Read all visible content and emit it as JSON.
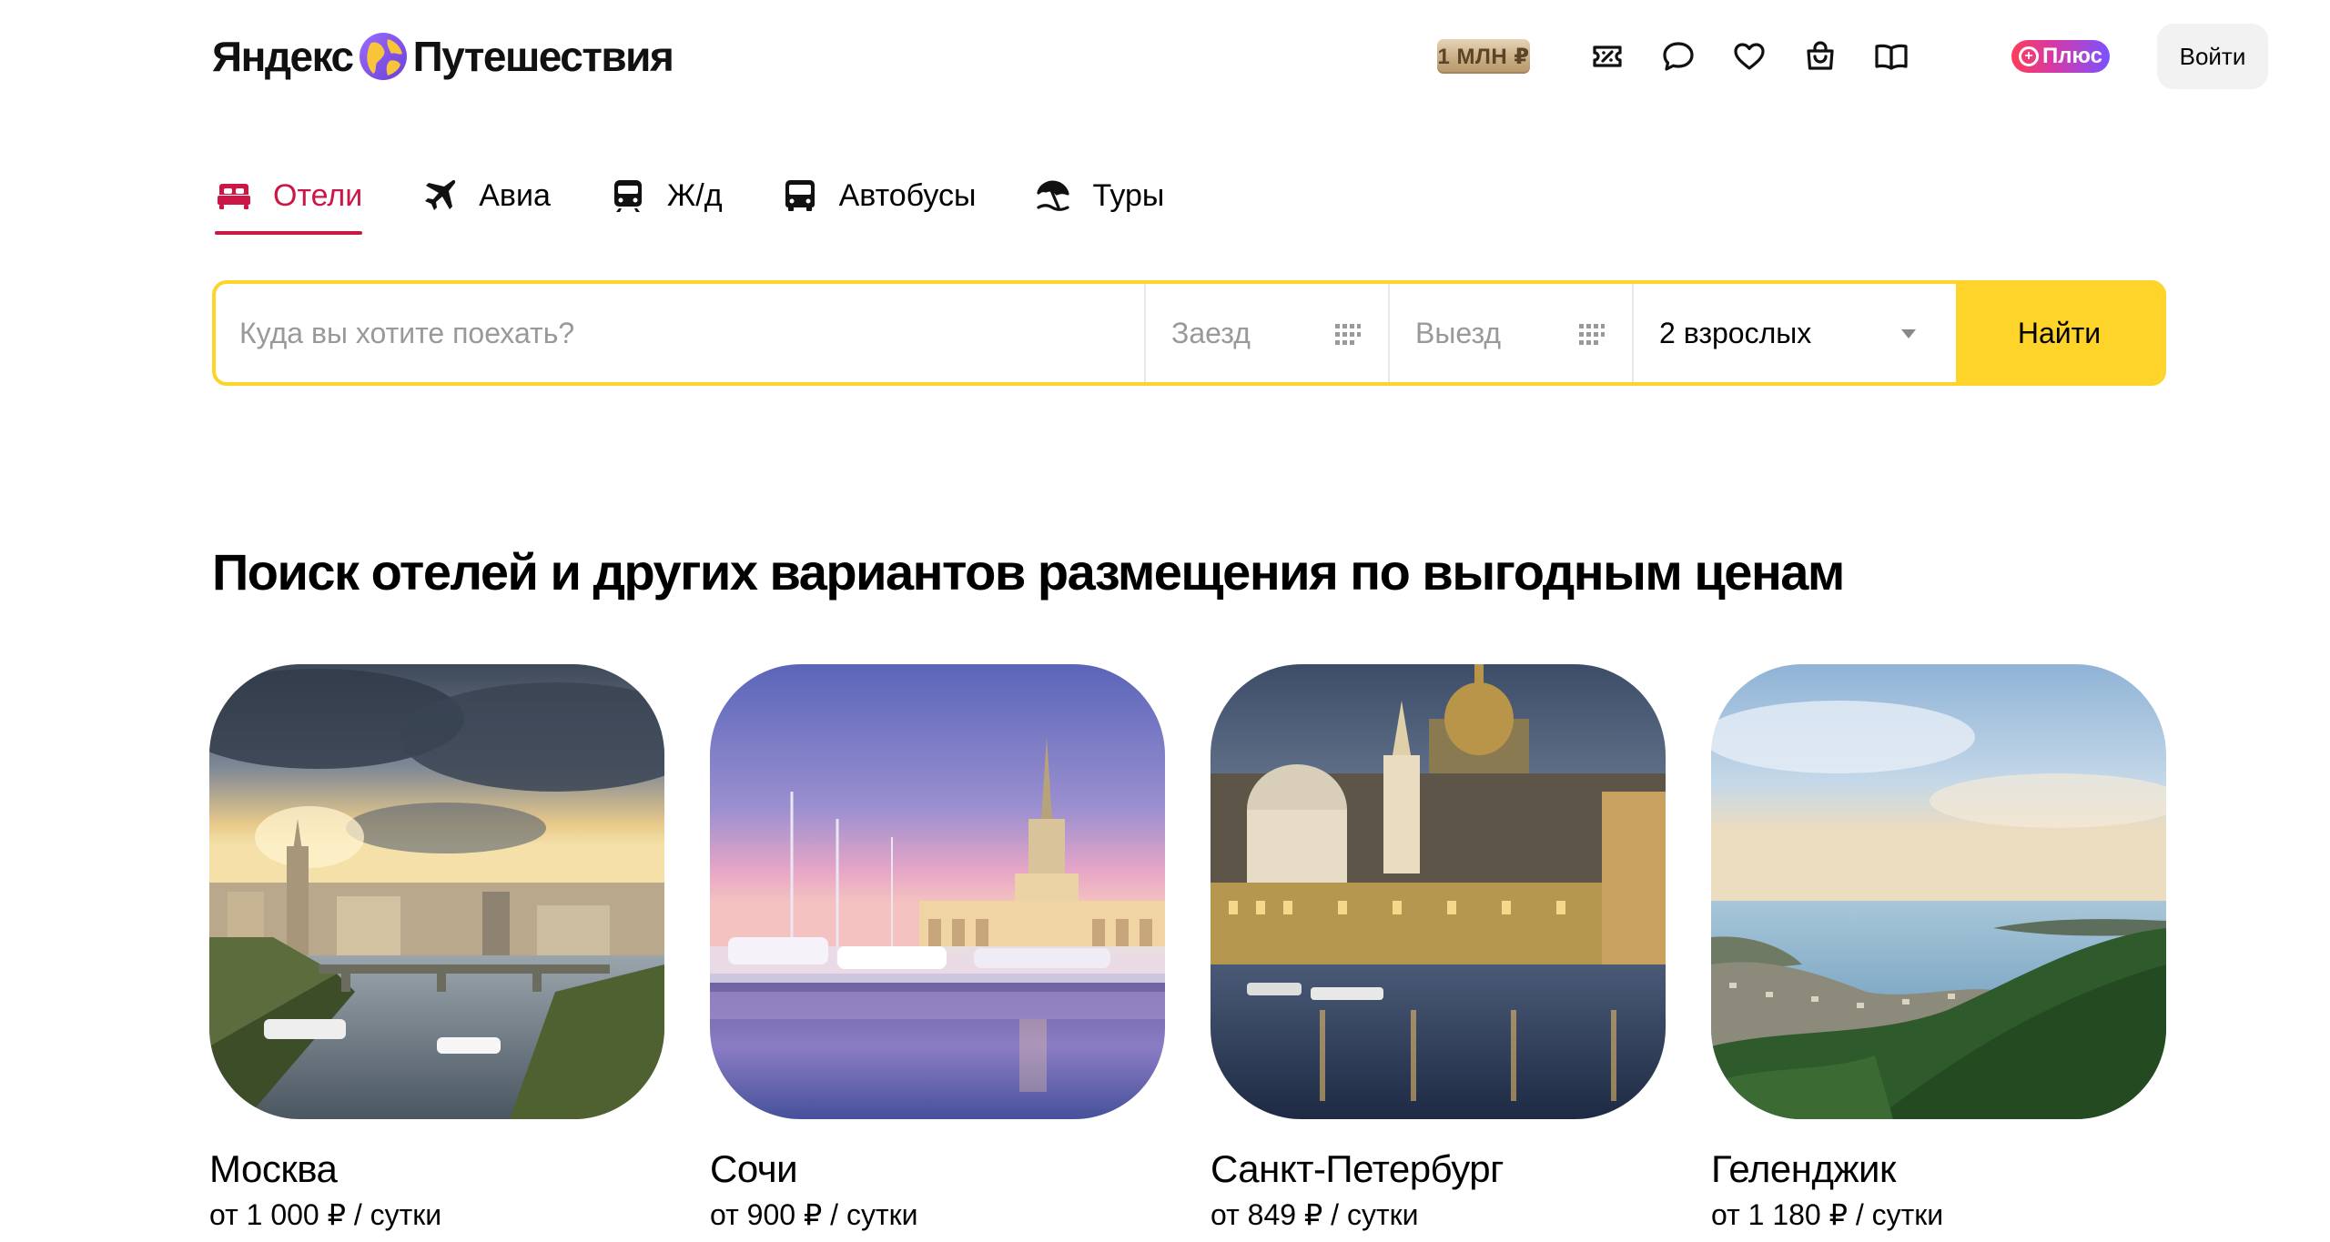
{
  "header": {
    "logo_left": "Яндекс",
    "logo_right": "Путешествия",
    "mln_badge": "1 МЛН ₽",
    "plus_label": "Плюс",
    "login_label": "Войти",
    "icons": [
      "percent-ticket-icon",
      "chat-icon",
      "heart-icon",
      "bag-icon",
      "book-icon"
    ]
  },
  "tabs": [
    {
      "label": "Отели",
      "icon": "bed-icon",
      "active": true
    },
    {
      "label": "Авиа",
      "icon": "plane-icon",
      "active": false
    },
    {
      "label": "Ж/д",
      "icon": "train-icon",
      "active": false
    },
    {
      "label": "Автобусы",
      "icon": "bus-icon",
      "active": false
    },
    {
      "label": "Туры",
      "icon": "beach-umbrella-icon",
      "active": false
    }
  ],
  "search": {
    "where_placeholder": "Куда вы хотите поехать?",
    "checkin_placeholder": "Заезд",
    "checkout_placeholder": "Выезд",
    "guests_value": "2 взрослых",
    "find_label": "Найти"
  },
  "heading": "Поиск отелей и других вариантов размещения по выгодным ценам",
  "cards": [
    {
      "city": "Москва",
      "price": "от 1 000 ₽ / сутки"
    },
    {
      "city": "Сочи",
      "price": "от 900 ₽ / сутки"
    },
    {
      "city": "Санкт-Петербург",
      "price": "от 849 ₽ / сутки"
    },
    {
      "city": "Геленджик",
      "price": "от 1 180 ₽ / сутки"
    }
  ],
  "colors": {
    "accent_red": "#cc1645",
    "search_yellow": "#fed42b",
    "login_bg": "#f2f2f2"
  }
}
